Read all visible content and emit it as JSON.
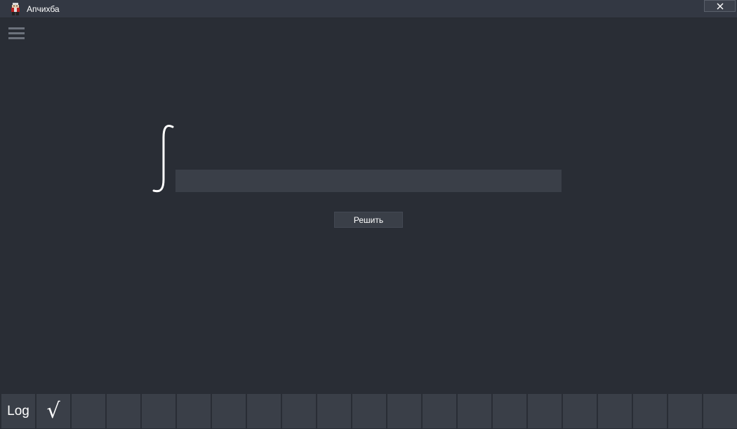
{
  "window": {
    "title": "Апчихба"
  },
  "main": {
    "integral_symbol": "∫",
    "expression_input": {
      "value": "",
      "placeholder": ""
    },
    "solve_button_label": "Решить"
  },
  "keypad": {
    "keys": [
      {
        "label": "Log"
      },
      {
        "label": "√"
      },
      {
        "label": ""
      },
      {
        "label": ""
      },
      {
        "label": ""
      },
      {
        "label": ""
      },
      {
        "label": ""
      },
      {
        "label": ""
      },
      {
        "label": ""
      },
      {
        "label": ""
      },
      {
        "label": ""
      },
      {
        "label": ""
      },
      {
        "label": ""
      },
      {
        "label": ""
      },
      {
        "label": ""
      },
      {
        "label": ""
      },
      {
        "label": ""
      },
      {
        "label": ""
      },
      {
        "label": ""
      },
      {
        "label": ""
      },
      {
        "label": ""
      }
    ]
  },
  "colors": {
    "background": "#292d35",
    "titlebar": "#333843",
    "panel": "#3a3f48",
    "text": "#ffffff",
    "menu_icon": "#6c727c"
  },
  "icons": {
    "app": "app-logo-icon",
    "close": "close-icon",
    "menu": "hamburger-menu-icon"
  }
}
